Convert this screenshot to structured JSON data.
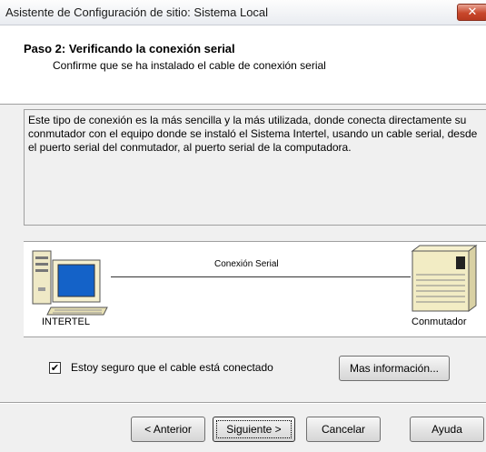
{
  "window": {
    "title": "Asistente de Configuración de sitio: Sistema Local",
    "close_glyph": "✕"
  },
  "header": {
    "step_title": "Paso 2: Verificando la conexión serial",
    "step_subtitle": "Confirme que se ha instalado el cable de conexión serial"
  },
  "description": "Este tipo de conexión es la más sencilla y la más utilizada, donde conecta directamente su conmutador con el equipo donde se instaló el Sistema Intertel, usando un cable serial, desde el puerto serial del conmutador, al puerto serial de la computadora.",
  "diagram": {
    "connection_label": "Conexión Serial",
    "left_label": "INTERTEL",
    "right_label": "Conmutador",
    "left_icon": "computer-icon",
    "right_icon": "switch-device-icon"
  },
  "confirm_checkbox": {
    "label": "Estoy seguro que el cable está conectado",
    "checked": true,
    "glyph": "✔"
  },
  "buttons": {
    "more_info": "Mas información...",
    "back": "< Anterior",
    "next": "Siguiente >",
    "cancel": "Cancelar",
    "help": "Ayuda"
  }
}
